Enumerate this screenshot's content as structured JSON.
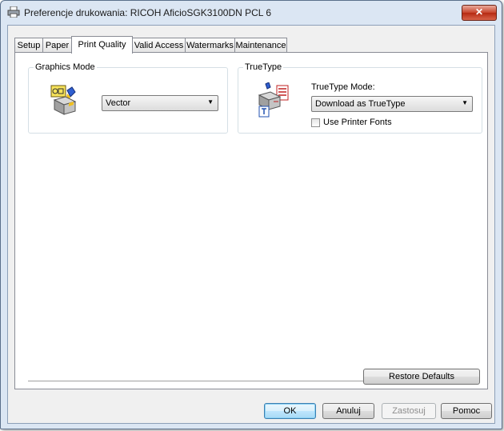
{
  "window": {
    "title": "Preferencje drukowania: RICOH AficioSGK3100DN PCL 6",
    "close_glyph": "✕"
  },
  "tabs": [
    {
      "label": "Setup"
    },
    {
      "label": "Paper"
    },
    {
      "label": "Print Quality"
    },
    {
      "label": "Valid Access"
    },
    {
      "label": "Watermarks"
    },
    {
      "label": "Maintenance"
    }
  ],
  "active_tab": "Print Quality",
  "graphics_mode": {
    "group_label": "Graphics Mode",
    "selected": "Vector",
    "icon": "graphics-mode-icon"
  },
  "truetype": {
    "group_label": "TrueType",
    "mode_label": "TrueType Mode:",
    "selected": "Download as TrueType",
    "use_printer_fonts_label": "Use Printer Fonts",
    "use_printer_fonts_checked": false,
    "icon": "truetype-icon"
  },
  "buttons": {
    "restore_defaults": "Restore Defaults",
    "ok": "OK",
    "apply_cancel": "Anuluj",
    "apply": "Zastosuj",
    "help": "Pomoc"
  },
  "dropdown_arrow": "▼"
}
